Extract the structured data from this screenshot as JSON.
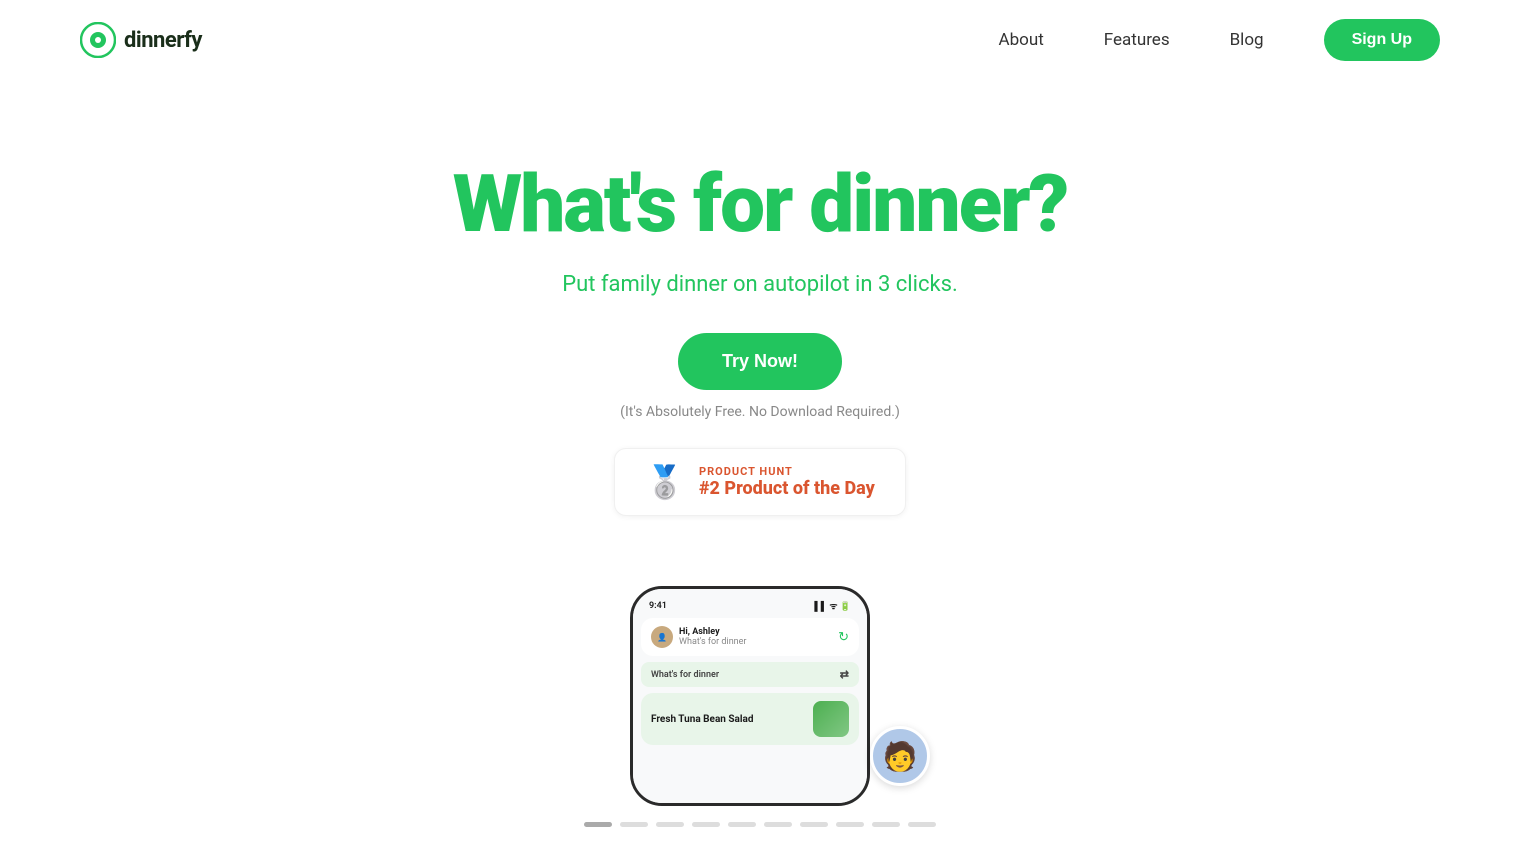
{
  "header": {
    "logo_text": "dinnerfy",
    "nav": {
      "about_label": "About",
      "features_label": "Features",
      "blog_label": "Blog",
      "signup_label": "Sign Up"
    }
  },
  "hero": {
    "title": "What's for dinner?",
    "subtitle": "Put family dinner on autopilot in 3 clicks.",
    "try_now_label": "Try Now!",
    "free_note": "(It's Absolutely Free. No Download Required.)",
    "product_hunt": {
      "label": "PRODUCT HUNT",
      "rank": "#2 Product of the Day"
    }
  },
  "phone": {
    "status_time": "9:41",
    "greeting_name": "Hi, Ashley",
    "greeting_sub": "What's for dinner",
    "section_header": "What's for dinner",
    "card_title": "Fresh Tuna Bean Salad"
  },
  "slider": {
    "dots_count": 10,
    "active_dot": 0
  },
  "floating_avatar": {
    "emoji": "🧑"
  },
  "colors": {
    "green": "#22c55e",
    "orange": "#da552f",
    "dark": "#1a2e1a"
  }
}
